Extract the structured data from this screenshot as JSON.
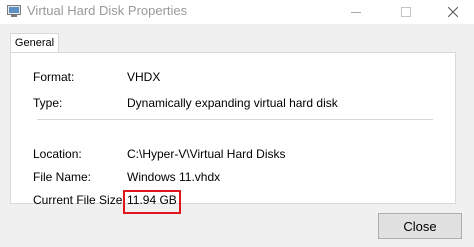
{
  "window": {
    "title": "Virtual Hard Disk Properties",
    "icon": "app-icon",
    "controls": [
      "minimize-icon",
      "maximize-icon",
      "close-icon"
    ]
  },
  "tabs": [
    {
      "label": "General",
      "selected": true
    }
  ],
  "properties": {
    "format": {
      "label": "Format:",
      "value": "VHDX"
    },
    "type": {
      "label": "Type:",
      "value": "Dynamically expanding virtual hard disk"
    },
    "location": {
      "label": "Location:",
      "value": "C:\\Hyper-V\\Virtual Hard Disks"
    },
    "file_name": {
      "label": "File Name:",
      "value": "Windows 11.vhdx"
    },
    "current_file_size": {
      "label": "Current File Size:",
      "value": "11.94 GB"
    }
  },
  "buttons": {
    "close_label": "Close"
  },
  "colors": {
    "highlight": "#e0161f",
    "title_text": "#9a9a9a"
  }
}
